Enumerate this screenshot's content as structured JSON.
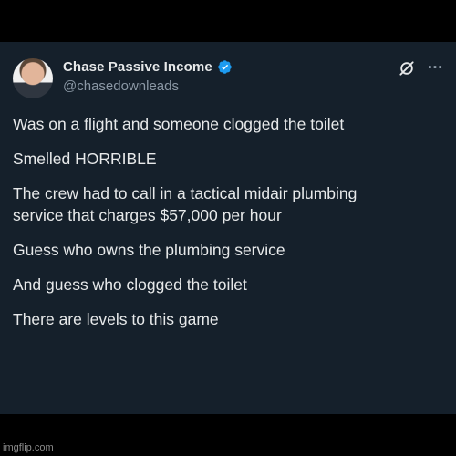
{
  "tweet": {
    "author": {
      "display_name": "Chase Passive Income",
      "handle": "@chasedownleads",
      "verified": true,
      "verified_color": "#1d9bf0"
    },
    "icons": {
      "grok": "grok-icon",
      "more": "more-options-icon",
      "more_glyph": "···"
    },
    "paragraphs": [
      [
        "Was on a flight and someone clogged the toilet"
      ],
      [
        "Smelled HORRIBLE"
      ],
      [
        "The crew had to call in a tactical midair plumbing",
        "service that charges $57,000 per hour"
      ],
      [
        "Guess who owns the plumbing service"
      ],
      [
        "And guess who clogged the toilet"
      ],
      [
        "There are levels to this game"
      ]
    ],
    "colors": {
      "background": "#15202b",
      "text": "#e7e9ea",
      "secondary_text": "#8b98a5"
    }
  },
  "watermark": "imgflip.com"
}
